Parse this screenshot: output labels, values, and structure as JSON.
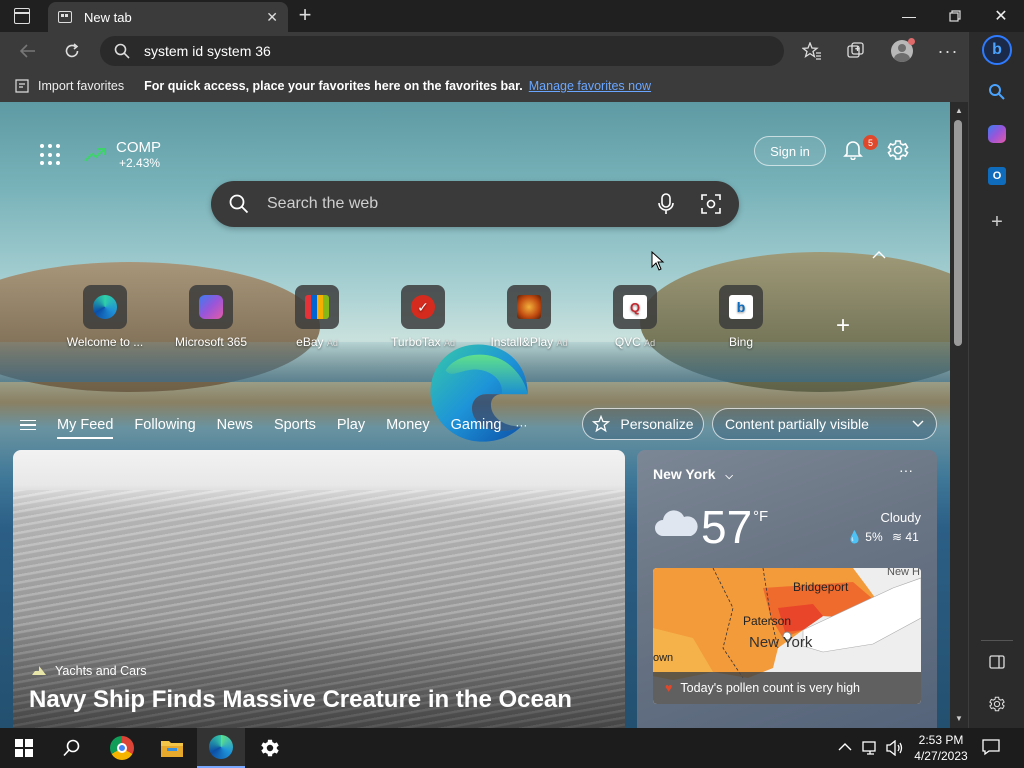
{
  "browser": {
    "tab_title": "New tab",
    "address": "system id system 36"
  },
  "favorites_bar": {
    "import_label": "Import favorites",
    "hint": "For quick access, place your favorites here on the favorites bar.",
    "manage_link": "Manage favorites now"
  },
  "newtab": {
    "stock_symbol": "COMP",
    "stock_change": "+2.43%",
    "sign_in": "Sign in",
    "notification_count": "5",
    "search_placeholder": "Search the web",
    "quick_links": [
      {
        "label": "Welcome to ...",
        "ad": "",
        "color": "#1f8fd6"
      },
      {
        "label": "Microsoft 365",
        "ad": "",
        "color": "#6b5cd6"
      },
      {
        "label": "eBay",
        "ad": "Ad",
        "color": "#e53238"
      },
      {
        "label": "TurboTax",
        "ad": "Ad",
        "color": "#d52b1e"
      },
      {
        "label": "Install&Play",
        "ad": "Ad",
        "color": "#c04a10"
      },
      {
        "label": "QVC",
        "ad": "Ad",
        "color": "#ffffff"
      },
      {
        "label": "Bing",
        "ad": "",
        "color": "#ffffff"
      }
    ],
    "feed_nav": [
      "My Feed",
      "Following",
      "News",
      "Sports",
      "Play",
      "Money",
      "Gaming"
    ],
    "more_nav": "···",
    "personalize": "Personalize",
    "content_visibility": "Content partially visible"
  },
  "news": {
    "source": "Yachts and Cars",
    "headline": "Navy Ship Finds Massive Creature in the Ocean"
  },
  "weather": {
    "city": "New York",
    "temperature": "57",
    "unit": "°F",
    "condition": "Cloudy",
    "precip": "5%",
    "aqi": "41",
    "map_labels": [
      "Bridgeport",
      "Paterson",
      "New York",
      "own",
      "New H"
    ],
    "pollen": "Today's pollen count is very high"
  },
  "taskbar": {
    "time": "2:53 PM",
    "date": "4/27/2023"
  },
  "colors": {
    "accent": "#6aa6ff",
    "badge": "#e0482b"
  }
}
